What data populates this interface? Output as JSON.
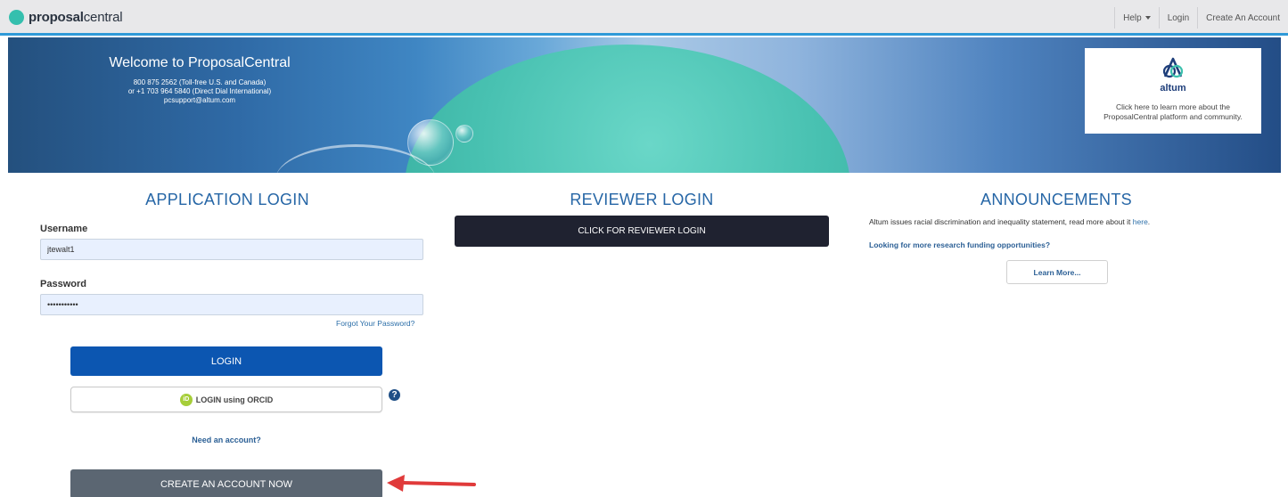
{
  "nav": {
    "logo_bold": "proposal",
    "logo_light": "central",
    "help": "Help",
    "login": "Login",
    "create_account": "Create An Account"
  },
  "banner": {
    "title": "Welcome to ProposalCentral",
    "phone_us": "800 875 2562 (Toll-free U.S. and Canada)",
    "phone_intl": "or +1 703 964 5840 (Direct Dial International)",
    "email": "pcsupport@altum.com",
    "altum_name": "altum",
    "altum_line1": "Click here to learn more about the",
    "altum_line2": "ProposalCentral platform and community."
  },
  "application": {
    "title": "APPLICATION LOGIN",
    "username_label": "Username",
    "username_value": "jtewalt1",
    "password_label": "Password",
    "password_value": "•••••••••••",
    "forgot": "Forgot Your Password?",
    "login_button": "LOGIN",
    "orcid_button": "LOGIN using ORCID",
    "orcid_badge": "iD",
    "help_symbol": "?",
    "need_account": "Need an account?",
    "create_button": "CREATE AN ACCOUNT NOW"
  },
  "reviewer": {
    "title": "REVIEWER LOGIN",
    "button": "CLICK FOR REVIEWER LOGIN"
  },
  "announcements": {
    "title": "ANNOUNCEMENTS",
    "statement": "Altum issues racial discrimination and inequality statement, read more about it",
    "statement_link": "here",
    "statement_end": ".",
    "funding_link": "Looking for more research funding opportunities?",
    "learn_more": "Learn More..."
  },
  "colors": {
    "accent": "#2666a6",
    "login_button": "#0c56b1",
    "reviewer_button": "#1f2230",
    "create_button": "#5b6672",
    "arrow": "#e03a3a"
  }
}
